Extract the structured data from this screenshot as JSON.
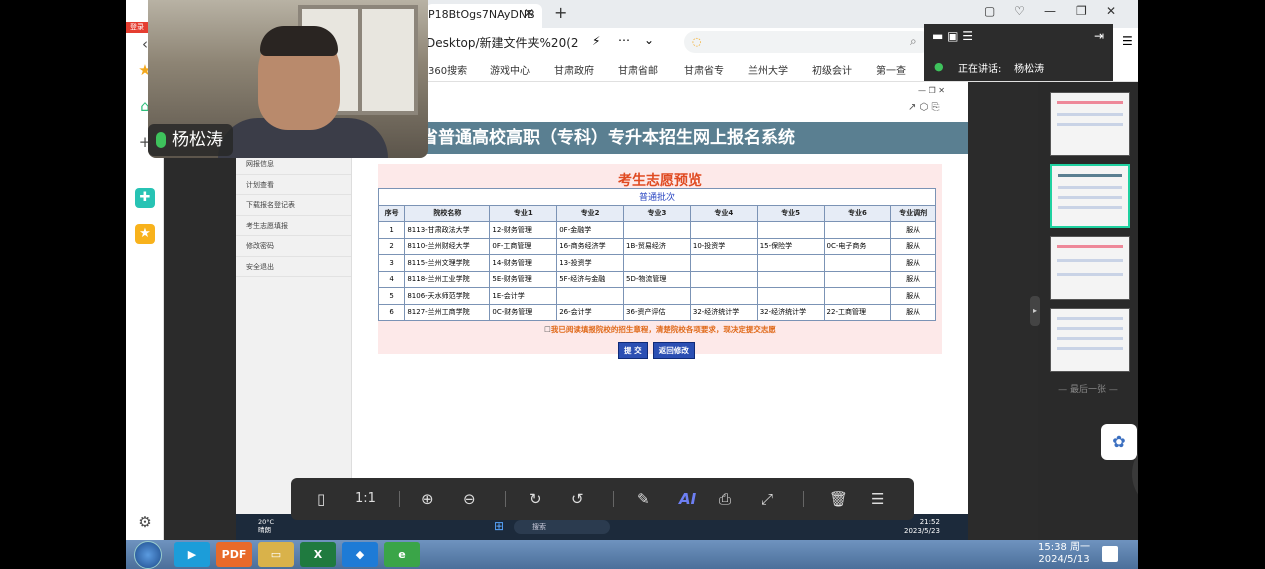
{
  "browser": {
    "tab_title": "P18BtOgs7NAyDNB",
    "address": "Desktop/新建文件夹%20(2",
    "search_placeholder": "",
    "badge": "登录",
    "bookmarks": [
      "360搜索",
      "游戏中心",
      "甘肃政府",
      "甘肃省邮",
      "甘肃省专",
      "兰州大学",
      "初级会计",
      "第一查"
    ]
  },
  "meeting": {
    "speaking_label": "正在讲话:",
    "speaker": "杨松涛",
    "participant_name": "杨松涛"
  },
  "system": {
    "header": "省普通高校高职（专科）专升本招生网上报名系统",
    "menu": [
      "网报信息",
      "计划查看",
      "下载报名登记表",
      "考生志愿填报",
      "修改密码",
      "安全退出"
    ],
    "preview_title": "考生志愿预览",
    "batch": "普通批次",
    "columns": [
      "序号",
      "院校名称",
      "专业1",
      "专业2",
      "专业3",
      "专业4",
      "专业5",
      "专业6",
      "专业调剂"
    ],
    "rows": [
      [
        "1",
        "8113-甘肃政法大学",
        "12-财务管理",
        "0F-金融学",
        "",
        "",
        "",
        "",
        "服从"
      ],
      [
        "2",
        "8110-兰州财经大学",
        "0F-工商管理",
        "16-商务经济学",
        "1B-贸易经济",
        "10-投资学",
        "15-保险学",
        "0C-电子商务",
        "服从"
      ],
      [
        "3",
        "8115-兰州文理学院",
        "14-财务管理",
        "13-投资学",
        "",
        "",
        "",
        "",
        "服从"
      ],
      [
        "4",
        "8118-兰州工业学院",
        "5E-财务管理",
        "5F-经济与金融",
        "5D-物流管理",
        "",
        "",
        "",
        "服从"
      ],
      [
        "5",
        "8106-天水师范学院",
        "1E-会计学",
        "",
        "",
        "",
        "",
        "",
        "服从"
      ],
      [
        "6",
        "8127-兰州工商学院",
        "0C-财务管理",
        "26-会计学",
        "36-资产评估",
        "32-经济统计学",
        "32-经济统计学",
        "22-工商管理",
        "服从"
      ]
    ],
    "notice": "我已阅读填报院校的招生章程，清楚院校各项要求，现决定提交志愿",
    "submit_label": "提 交",
    "back_label": "返回修改",
    "inner_search": "搜索",
    "inner_weather_temp": "20°C",
    "inner_weather_desc": "晴朗",
    "inner_time": "21:52",
    "inner_date": "2023/5/23"
  },
  "viewer": {
    "zoom_label": "1:1",
    "ai_label": "AI",
    "last_page_label": "— 最后一张 —"
  },
  "taskbar": {
    "time": "15:38 周一",
    "date": "2024/5/13"
  }
}
